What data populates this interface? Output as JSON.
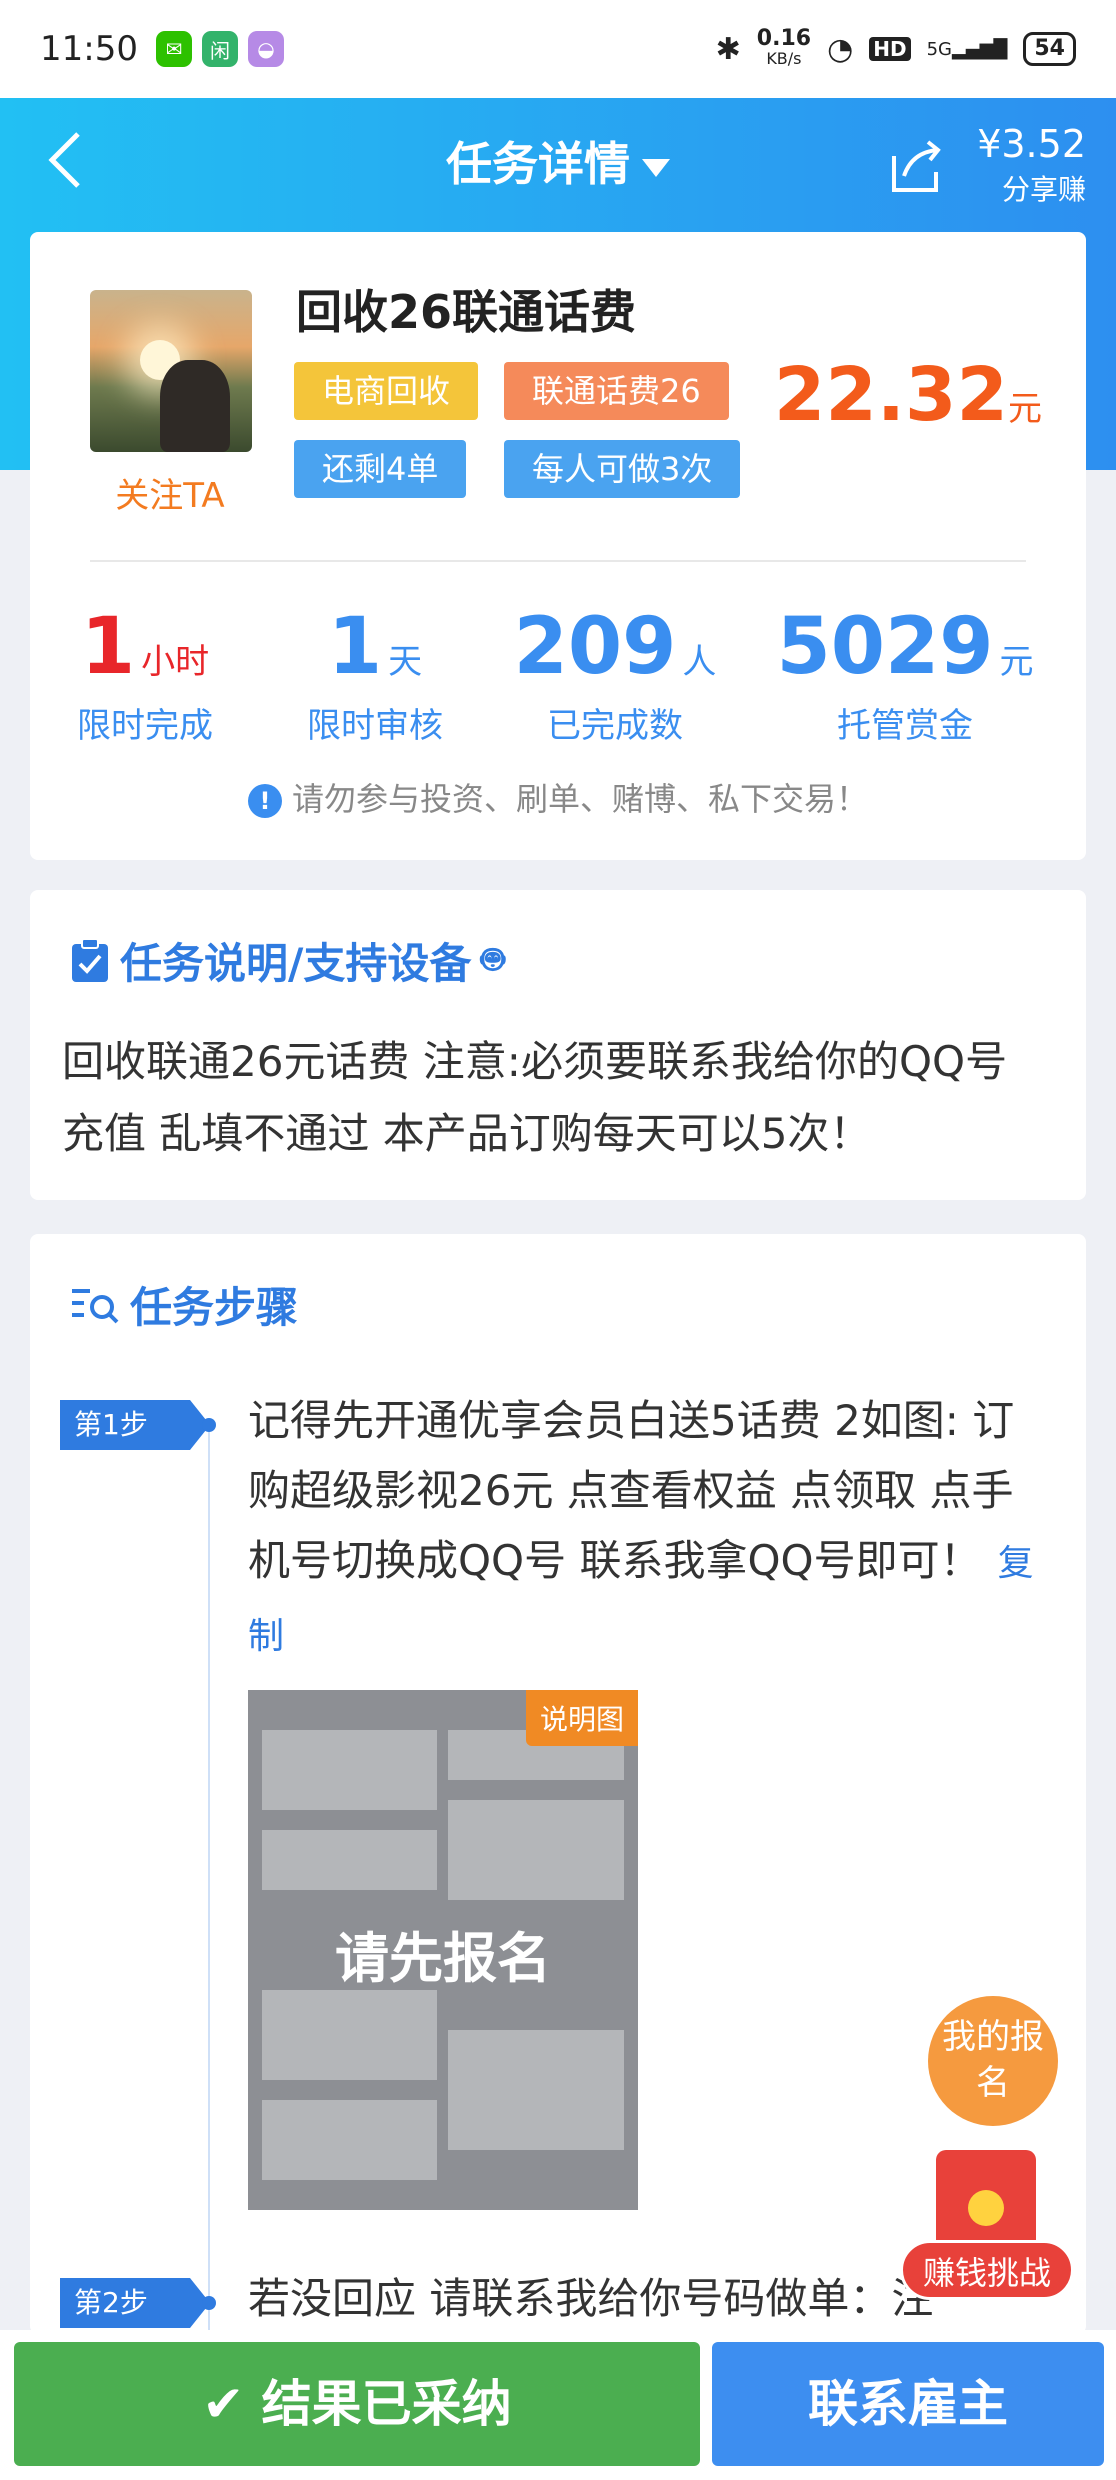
{
  "status_bar": {
    "time": "11:50",
    "net_speed": "0.16",
    "net_unit": "KB/s",
    "hd": "HD",
    "signal": "5G",
    "battery": "54"
  },
  "nav": {
    "title": "任务详情",
    "share_amount": "¥3.52",
    "share_label": "分享赚"
  },
  "task": {
    "title": "回收26联通话费",
    "follow": "关注TA",
    "tags": [
      "电商回收",
      "联通话费26",
      "还剩4单",
      "每人可做3次"
    ],
    "price": "22.32",
    "price_unit": "元",
    "stats": [
      {
        "value": "1",
        "unit": "小时",
        "label": "限时完成"
      },
      {
        "value": "1",
        "unit": "天",
        "label": "限时审核"
      },
      {
        "value": "209",
        "unit": "人",
        "label": "已完成数"
      },
      {
        "value": "5029",
        "unit": "元",
        "label": "托管赏金"
      }
    ],
    "warning": "请勿参与投资、刷单、赌博、私下交易！"
  },
  "description": {
    "title": "任务说明/支持设备",
    "text": "回收联通26元话费 注意:必须要联系我给你的QQ号充值 乱填不通过 本产品订购每天可以5次！"
  },
  "steps": {
    "title": "任务步骤",
    "items": [
      {
        "badge": "第1步",
        "text": "记得先开通优享会员白送5话费 2如图: 订购超级影视26元 点查看权益 点领取 点手机号切换成QQ号 联系我拿QQ号即可！",
        "copy": "复制",
        "image_label": "说明图",
        "image_overlay": "请先报名"
      },
      {
        "badge": "第2步",
        "text": "若没回应 请联系我给你号码做单：注"
      }
    ]
  },
  "floating": {
    "my_signup": "我的报名",
    "earn_challenge": "赚钱挑战"
  },
  "bottom": {
    "left_button": "结果已采纳",
    "right_button": "联系雇主"
  },
  "colors": {
    "accent": "#2f7be0",
    "price": "#f35b1b",
    "green": "#4bae50"
  }
}
